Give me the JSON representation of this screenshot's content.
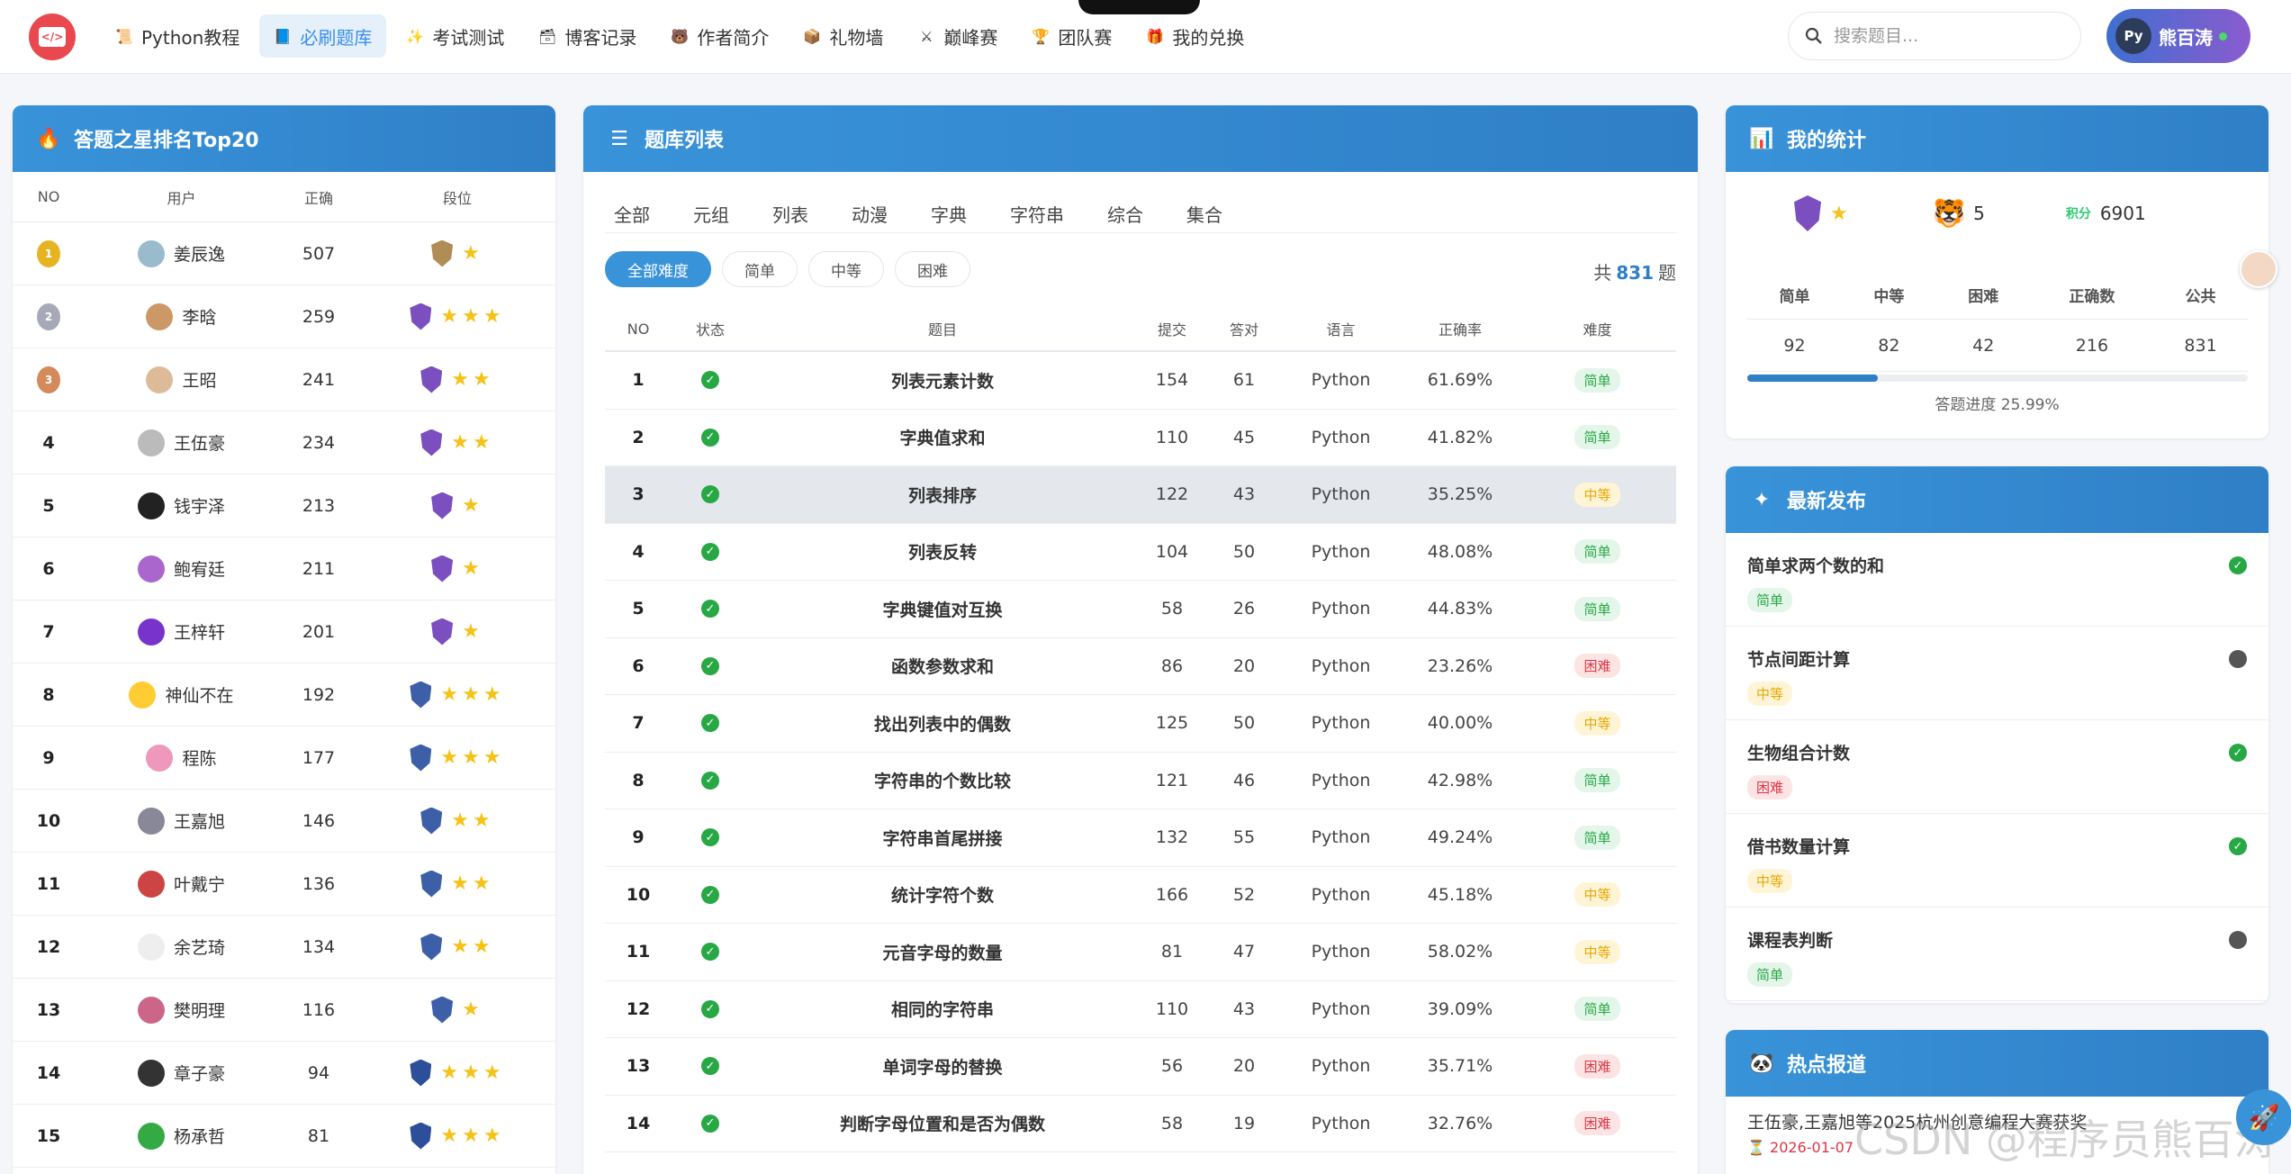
{
  "nav": {
    "items": [
      {
        "label": "Python教程",
        "icon": "scroll-icon"
      },
      {
        "label": "必刷题库",
        "icon": "book-icon",
        "active": true
      },
      {
        "label": "考试测试",
        "icon": "sparkle-icon"
      },
      {
        "label": "博客记录",
        "icon": "box-icon"
      },
      {
        "label": "作者简介",
        "icon": "bear-icon"
      },
      {
        "label": "礼物墙",
        "icon": "package-icon"
      },
      {
        "label": "巅峰赛",
        "icon": "swords-icon"
      },
      {
        "label": "团队赛",
        "icon": "trophy-icon"
      },
      {
        "label": "我的兑换",
        "icon": "gift-icon"
      }
    ],
    "search_placeholder": "搜索题目...",
    "username": "熊百涛"
  },
  "ranking": {
    "title": "答题之星排名Top20",
    "headers": {
      "no": "NO",
      "user": "用户",
      "correct": "正确",
      "level": "段位"
    },
    "rows": [
      {
        "no": "1",
        "name": "姜辰逸",
        "correct": "507",
        "stars": 1,
        "shield": "#b08d57",
        "medal": "#e6b422"
      },
      {
        "no": "2",
        "name": "李晗",
        "correct": "259",
        "stars": 3,
        "shield": "#7b4fbf",
        "medal": "#a7a9b8"
      },
      {
        "no": "3",
        "name": "王昭",
        "correct": "241",
        "stars": 2,
        "shield": "#7b4fbf",
        "medal": "#d48a5a"
      },
      {
        "no": "4",
        "name": "王伍豪",
        "correct": "234",
        "stars": 2,
        "shield": "#7b4fbf"
      },
      {
        "no": "5",
        "name": "钱宇泽",
        "correct": "213",
        "stars": 1,
        "shield": "#7b4fbf"
      },
      {
        "no": "6",
        "name": "鲍宥廷",
        "correct": "211",
        "stars": 1,
        "shield": "#7b4fbf"
      },
      {
        "no": "7",
        "name": "王梓轩",
        "correct": "201",
        "stars": 1,
        "shield": "#7b4fbf"
      },
      {
        "no": "8",
        "name": "神仙不在",
        "correct": "192",
        "stars": 3,
        "shield": "#3d5fa8"
      },
      {
        "no": "9",
        "name": "程陈",
        "correct": "177",
        "stars": 3,
        "shield": "#3d5fa8"
      },
      {
        "no": "10",
        "name": "王嘉旭",
        "correct": "146",
        "stars": 2,
        "shield": "#3d5fa8"
      },
      {
        "no": "11",
        "name": "叶戴宁",
        "correct": "136",
        "stars": 2,
        "shield": "#3d5fa8"
      },
      {
        "no": "12",
        "name": "余艺琦",
        "correct": "134",
        "stars": 2,
        "shield": "#3d5fa8"
      },
      {
        "no": "13",
        "name": "樊明理",
        "correct": "116",
        "stars": 1,
        "shield": "#3d5fa8"
      },
      {
        "no": "14",
        "name": "章子豪",
        "correct": "94",
        "stars": 3,
        "shield": "#2d4f9a"
      },
      {
        "no": "15",
        "name": "杨承哲",
        "correct": "81",
        "stars": 3,
        "shield": "#2d4f9a"
      }
    ]
  },
  "questions": {
    "title": "题库列表",
    "tabs": [
      "全部",
      "元组",
      "列表",
      "动漫",
      "字典",
      "字符串",
      "综合",
      "集合"
    ],
    "filters": [
      "全部难度",
      "简单",
      "中等",
      "困难"
    ],
    "total_prefix": "共",
    "total": "831",
    "total_suffix": "题",
    "headers": {
      "no": "NO",
      "status": "状态",
      "title": "题目",
      "submit": "提交",
      "ac": "答对",
      "lang": "语言",
      "rate": "正确率",
      "diff": "难度"
    },
    "rows": [
      {
        "no": "1",
        "title": "列表元素计数",
        "submit": "154",
        "ac": "61",
        "lang": "Python",
        "rate": "61.69%",
        "diff": "简单",
        "level": "easy"
      },
      {
        "no": "2",
        "title": "字典值求和",
        "submit": "110",
        "ac": "45",
        "lang": "Python",
        "rate": "41.82%",
        "diff": "简单",
        "level": "easy"
      },
      {
        "no": "3",
        "title": "列表排序",
        "submit": "122",
        "ac": "43",
        "lang": "Python",
        "rate": "35.25%",
        "diff": "中等",
        "level": "mid",
        "highlight": true
      },
      {
        "no": "4",
        "title": "列表反转",
        "submit": "104",
        "ac": "50",
        "lang": "Python",
        "rate": "48.08%",
        "diff": "简单",
        "level": "easy"
      },
      {
        "no": "5",
        "title": "字典键值对互换",
        "submit": "58",
        "ac": "26",
        "lang": "Python",
        "rate": "44.83%",
        "diff": "简单",
        "level": "easy"
      },
      {
        "no": "6",
        "title": "函数参数求和",
        "submit": "86",
        "ac": "20",
        "lang": "Python",
        "rate": "23.26%",
        "diff": "困难",
        "level": "hard"
      },
      {
        "no": "7",
        "title": "找出列表中的偶数",
        "submit": "125",
        "ac": "50",
        "lang": "Python",
        "rate": "40.00%",
        "diff": "中等",
        "level": "mid"
      },
      {
        "no": "8",
        "title": "字符串的个数比较",
        "submit": "121",
        "ac": "46",
        "lang": "Python",
        "rate": "42.98%",
        "diff": "简单",
        "level": "easy"
      },
      {
        "no": "9",
        "title": "字符串首尾拼接",
        "submit": "132",
        "ac": "55",
        "lang": "Python",
        "rate": "49.24%",
        "diff": "简单",
        "level": "easy"
      },
      {
        "no": "10",
        "title": "统计字符个数",
        "submit": "166",
        "ac": "52",
        "lang": "Python",
        "rate": "45.18%",
        "diff": "中等",
        "level": "mid"
      },
      {
        "no": "11",
        "title": "元音字母的数量",
        "submit": "81",
        "ac": "47",
        "lang": "Python",
        "rate": "58.02%",
        "diff": "中等",
        "level": "mid"
      },
      {
        "no": "12",
        "title": "相同的字符串",
        "submit": "110",
        "ac": "43",
        "lang": "Python",
        "rate": "39.09%",
        "diff": "简单",
        "level": "easy"
      },
      {
        "no": "13",
        "title": "单词字母的替换",
        "submit": "56",
        "ac": "20",
        "lang": "Python",
        "rate": "35.71%",
        "diff": "困难",
        "level": "hard"
      },
      {
        "no": "14",
        "title": "判断字母位置和是否为偶数",
        "submit": "58",
        "ac": "19",
        "lang": "Python",
        "rate": "32.76%",
        "diff": "困难",
        "level": "hard"
      }
    ]
  },
  "stats": {
    "title": "我的统计",
    "badge_count": "5",
    "score_label": "积分",
    "score": "6901",
    "headers": [
      "简单",
      "中等",
      "困难",
      "正确数",
      "公共"
    ],
    "values": [
      "92",
      "82",
      "42",
      "216",
      "831"
    ],
    "progress_label": "答题进度 25.99%",
    "progress": 0.2599
  },
  "latest": {
    "title": "最新发布",
    "items": [
      {
        "title": "简单求两个数的和",
        "diff": "简单",
        "level": "easy",
        "done": true
      },
      {
        "title": "节点间距计算",
        "diff": "中等",
        "level": "mid",
        "done": false
      },
      {
        "title": "生物组合计数",
        "diff": "困难",
        "level": "hard",
        "done": true
      },
      {
        "title": "借书数量计算",
        "diff": "中等",
        "level": "mid",
        "done": true
      },
      {
        "title": "课程表判断",
        "diff": "简单",
        "level": "easy",
        "done": false
      }
    ]
  },
  "hot": {
    "title": "热点报道",
    "item": "王伍豪,王嘉旭等2025杭州创意编程大赛获奖",
    "date": "2026-01-07"
  },
  "watermark": "CSDN @程序员熊百涛",
  "colors": {
    "primary": "#3993d9",
    "easy": "#28a745",
    "mid": "#e6a700",
    "hard": "#dc3545"
  }
}
